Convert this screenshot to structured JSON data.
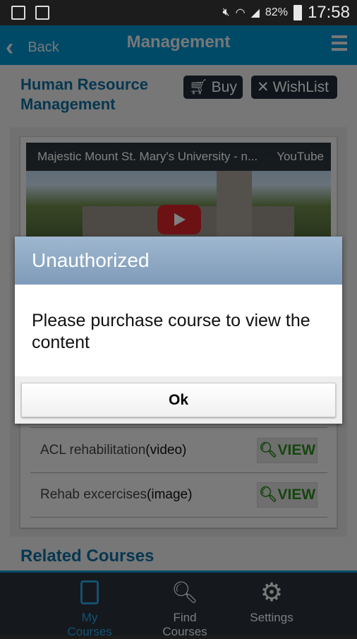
{
  "status_bar": {
    "battery": "82%",
    "time": "17:58"
  },
  "header": {
    "back_label": "Back",
    "title": "Management"
  },
  "course": {
    "title_line1": "Human Resource",
    "title_line2": "Management",
    "buy_label": "Buy",
    "wishlist_label": "WishList"
  },
  "video": {
    "title": "Majestic Mount St. Mary's University - n...",
    "source": "YouTube"
  },
  "materials": [
    {
      "name": "ACL rehabilitation",
      "type": "(video)",
      "action": "VIEW"
    },
    {
      "name": "Rehab excercises",
      "type": "(image)",
      "action": "VIEW"
    }
  ],
  "related_heading": "Related Courses",
  "bottom_nav": [
    {
      "label": "My Courses",
      "active": true
    },
    {
      "label": "Find Courses"
    },
    {
      "label": "Settings"
    }
  ],
  "dialog": {
    "title": "Unauthorized",
    "message": "Please purchase course to view the content",
    "ok_label": "Ok"
  },
  "colors": {
    "accent": "#0095d0",
    "heading": "#0e6ea0",
    "view_green": "#2d8a1e"
  }
}
